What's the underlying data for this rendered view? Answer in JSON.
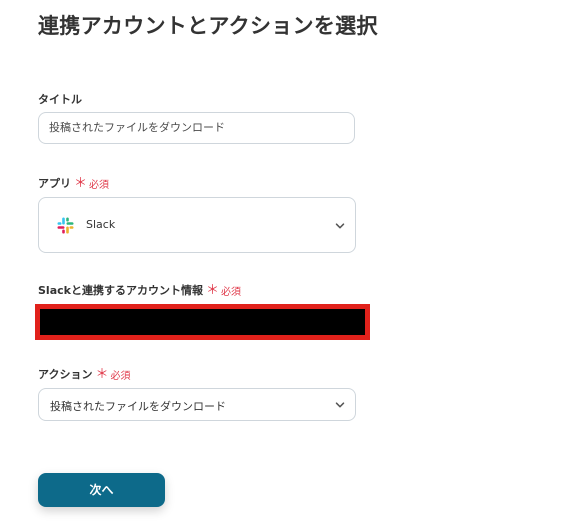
{
  "page": {
    "title": "連携アカウントとアクションを選択"
  },
  "fields": {
    "title": {
      "label": "タイトル",
      "value": "投稿されたファイルをダウンロード"
    },
    "app": {
      "label": "アプリ",
      "required_mark": "＊",
      "required_text": "必須",
      "value": "Slack",
      "icon": "slack-icon"
    },
    "account": {
      "label": "Slackと連携するアカウント情報",
      "required_mark": "＊",
      "required_text": "必須"
    },
    "action": {
      "label": "アクション",
      "required_mark": "＊",
      "required_text": "必須",
      "value": "投稿されたファイルをダウンロード"
    }
  },
  "buttons": {
    "next_label": "次へ"
  },
  "colors": {
    "primary": "#0d6a8a",
    "required": "#e0394a",
    "redaction_border": "#e1211b",
    "border": "#cfd6dc"
  }
}
